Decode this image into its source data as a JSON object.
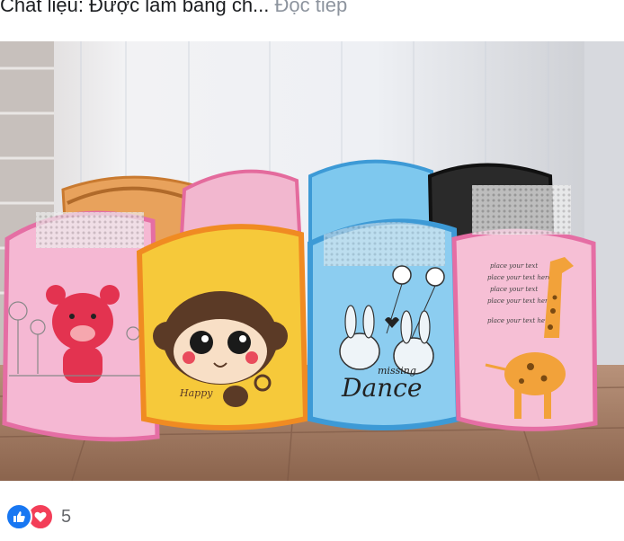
{
  "post": {
    "caption_text": "Chất liệu: Được làm bằng ch...",
    "caption_more": "Đọc tiếp"
  },
  "photo": {
    "basket_texts": {
      "monkey_tag": "Happy",
      "bunny_small": "missing",
      "bunny_big": "Dance",
      "giraffe_lines": [
        "place your text",
        "place your text here",
        "place your text",
        "place your text here",
        "place your text here"
      ]
    }
  },
  "reactions": {
    "count": "5",
    "icons": [
      "like-icon",
      "love-icon"
    ],
    "colors": {
      "like": "#1877f2",
      "love": "#f33e58"
    }
  }
}
